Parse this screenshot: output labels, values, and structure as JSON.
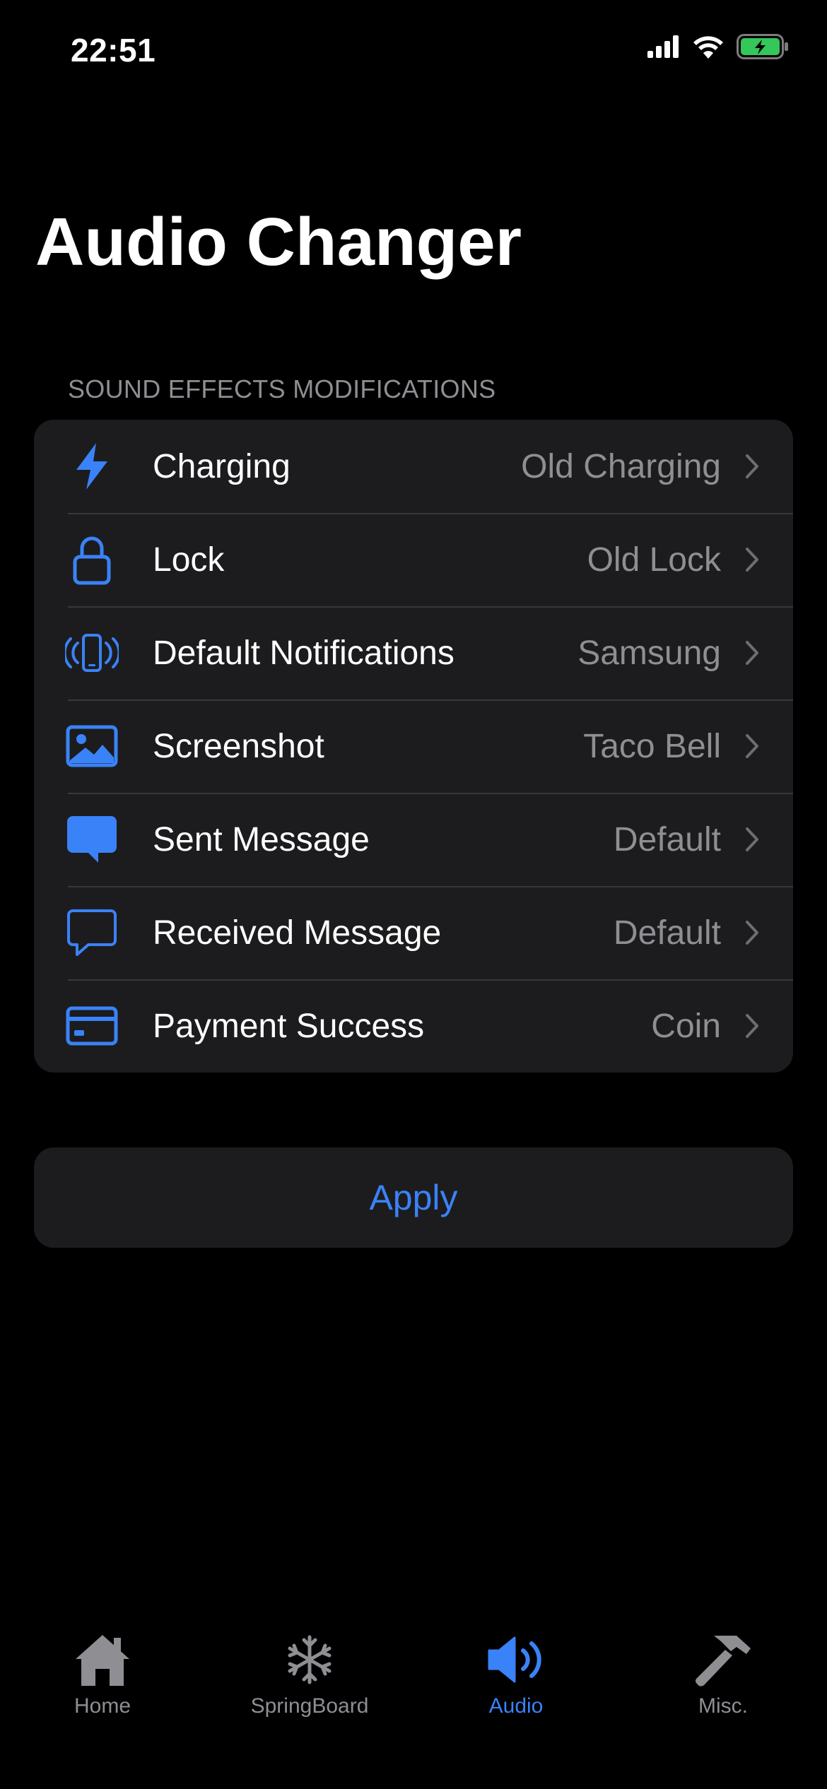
{
  "status_bar": {
    "time": "22:51"
  },
  "title": "Audio Changer",
  "section_header": "SOUND EFFECTS MODIFICATIONS",
  "rows": [
    {
      "label": "Charging",
      "value": "Old Charging",
      "icon": "bolt-icon"
    },
    {
      "label": "Lock",
      "value": "Old Lock",
      "icon": "lock-icon"
    },
    {
      "label": "Default Notifications",
      "value": "Samsung",
      "icon": "phone-vibrate-icon"
    },
    {
      "label": "Screenshot",
      "value": "Taco Bell",
      "icon": "photo-icon"
    },
    {
      "label": "Sent Message",
      "value": "Default",
      "icon": "message-filled-icon"
    },
    {
      "label": "Received Message",
      "value": "Default",
      "icon": "message-outline-icon"
    },
    {
      "label": "Payment Success",
      "value": "Coin",
      "icon": "credit-card-icon"
    }
  ],
  "apply_label": "Apply",
  "tabs": [
    {
      "label": "Home",
      "icon": "house-icon",
      "active": false
    },
    {
      "label": "SpringBoard",
      "icon": "snowflake-icon",
      "active": false
    },
    {
      "label": "Audio",
      "icon": "speaker-icon",
      "active": true
    },
    {
      "label": "Misc.",
      "icon": "hammer-icon",
      "active": false
    }
  ],
  "colors": {
    "accent": "#3a82f7",
    "background": "#000000",
    "card": "#1c1c1e",
    "secondary_text": "#8e8e93",
    "battery": "#34c759"
  }
}
